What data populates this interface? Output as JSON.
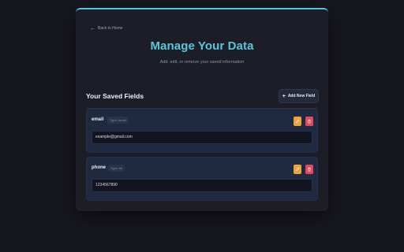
{
  "nav": {
    "back_label": "Back to Home"
  },
  "header": {
    "title": "Manage Your Data",
    "subtitle": "Add, edit, or remove your saved information"
  },
  "section": {
    "title": "Your Saved Fields",
    "add_button_label": "Add New Field"
  },
  "fields": [
    {
      "name": "email",
      "type_label": "Type: email",
      "value": "example@gmail.com"
    },
    {
      "name": "phone",
      "type_label": "Type: tel",
      "value": "1234567890"
    }
  ],
  "colors": {
    "accent": "#56c8dd",
    "edit": "#f0a13a",
    "delete": "#e34a5d",
    "background": "#17171f",
    "card": "#1c1d27"
  },
  "icons": {
    "back": "arrow-left-icon",
    "add": "plus-icon",
    "edit": "pencil-icon",
    "delete": "trash-icon"
  }
}
